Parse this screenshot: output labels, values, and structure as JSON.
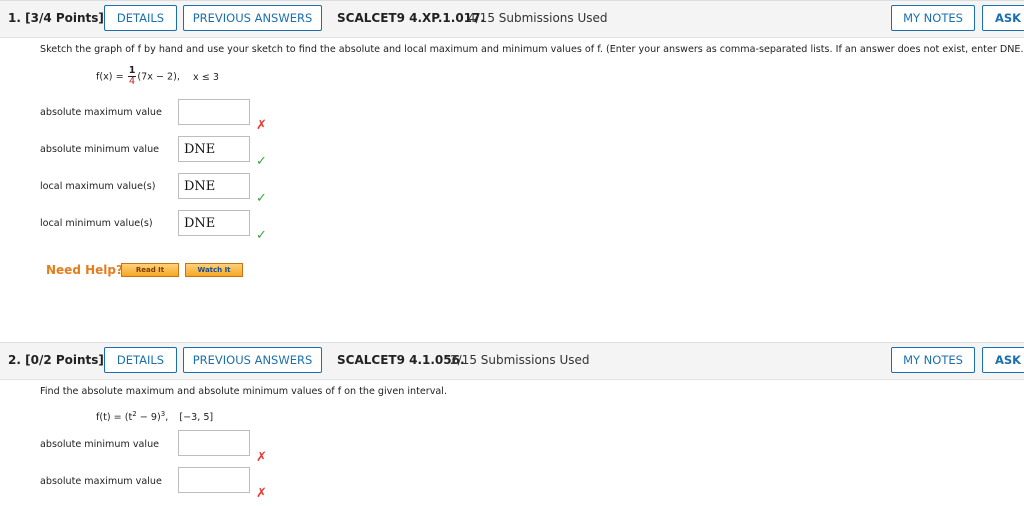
{
  "q1": {
    "number": "1.",
    "points": "[3/4 Points]",
    "details_label": "DETAILS",
    "previous_answers_label": "PREVIOUS ANSWERS",
    "code": "SCALCET9 4.XP.1.017.",
    "submissions": "4/15 Submissions Used",
    "my_notes_label": "MY NOTES",
    "ask_label": "ASK Y",
    "instructions": "Sketch the graph of f by hand and use your sketch to find the absolute and local maximum and minimum values of f. (Enter your answers as comma-separated lists. If an answer does not exist, enter DNE.)",
    "formula": {
      "lhs": "f(x) =",
      "frac_num": "1",
      "frac_den": "4",
      "expr": "(7x − 2),",
      "domain": "x ≤ 3"
    },
    "rows": [
      {
        "label": "absolute maximum value",
        "value": "",
        "status": "incorrect"
      },
      {
        "label": "absolute minimum value",
        "value": "DNE",
        "status": "correct"
      },
      {
        "label": "local maximum value(s)",
        "value": "DNE",
        "status": "correct"
      },
      {
        "label": "local minimum value(s)",
        "value": "DNE",
        "status": "correct"
      }
    ],
    "need_help": "Need Help?",
    "read_it": "Read It",
    "watch_it": "Watch It"
  },
  "q2": {
    "number": "2.",
    "points": "[0/2 Points]",
    "details_label": "DETAILS",
    "previous_answers_label": "PREVIOUS ANSWERS",
    "code": "SCALCET9 4.1.056.",
    "submissions": "2/15 Submissions Used",
    "my_notes_label": "MY NOTES",
    "ask_label": "ASK Y",
    "instructions": "Find the absolute maximum and absolute minimum values of f on the given interval.",
    "formula": {
      "lhs": "f(t) = (t",
      "sup1": "2",
      "mid": " − 9)",
      "sup2": "3",
      "sep": ",",
      "interval": "[−3, 5]"
    },
    "rows": [
      {
        "label": "absolute minimum value",
        "value": "",
        "status": "incorrect"
      },
      {
        "label": "absolute maximum value",
        "value": "",
        "status": "incorrect"
      }
    ]
  },
  "icons": {
    "correct": "check-icon",
    "incorrect": "x-icon"
  },
  "colors": {
    "accent": "#1b6fae",
    "correct": "#43a047",
    "incorrect": "#e53935",
    "help": "#e57c1d"
  }
}
